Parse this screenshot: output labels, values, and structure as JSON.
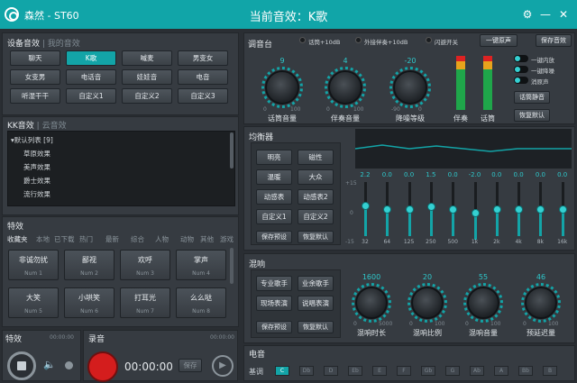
{
  "app": {
    "name": "森然 - ST60",
    "title": "当前音效：K歌"
  },
  "device_effects": {
    "title": "设备音效",
    "sub": "我的音效",
    "buttons": [
      "聊天",
      "K歌",
      "喊麦",
      "男变女",
      "女变男",
      "电话音",
      "娃娃音",
      "电音",
      "听湿干干",
      "自定义1",
      "自定义2",
      "自定义3"
    ],
    "active": "K歌"
  },
  "kk_effects": {
    "title": "KK音效",
    "sub": "云音效",
    "list": [
      "▾默认列表 [9]",
      "草原效果",
      "美声效果",
      "爵士效果",
      "流行效果"
    ]
  },
  "special": {
    "title": "特效",
    "tabs": [
      "收藏夹",
      "本地",
      "已下载",
      "热门",
      "最新",
      "综合",
      "人物",
      "动物",
      "其他",
      "游戏"
    ],
    "active_tab": "收藏夹",
    "buttons": [
      {
        "name": "非诚勿扰",
        "key": "Num 1"
      },
      {
        "name": "鄙视",
        "key": "Num 2"
      },
      {
        "name": "欢呼",
        "key": "Num 3"
      },
      {
        "name": "掌声",
        "key": "Num 4"
      },
      {
        "name": "大笑",
        "key": "Num 5"
      },
      {
        "name": "小哄笑",
        "key": "Num 6"
      },
      {
        "name": "打耳光",
        "key": "Num 7"
      },
      {
        "name": "么么哒",
        "key": "Num 8"
      }
    ]
  },
  "bottom": {
    "effect_label": "特效",
    "effect_time": "00:00:00",
    "record_label": "录音",
    "record_time": "00:00:00",
    "record_time_big": "00:00:00",
    "save": "保存"
  },
  "mixer": {
    "title": "调音台",
    "checks": [
      "话筒+10dB",
      "外接伴奏+10dB",
      "闪避开关"
    ],
    "btn_karaoke": "一键原声",
    "btn_save": "保存音效",
    "knobs": [
      {
        "label": "话筒音量",
        "value": "9"
      },
      {
        "label": "伴奏音量",
        "value": "4"
      },
      {
        "label": "降噪等级",
        "value": "-20"
      }
    ],
    "knob_marks": [
      "0",
      "100",
      "0",
      "100",
      "-90",
      "0"
    ],
    "vu_labels": [
      "伴奏",
      "话筒"
    ],
    "toggles": [
      "一键内放",
      "一键降噪",
      "消原声"
    ],
    "btn_mute": "话筒静音",
    "btn_reset": "恢复默认"
  },
  "eq": {
    "title": "均衡器",
    "presets": [
      "明亮",
      "磁性",
      "温暖",
      "大众",
      "动感表",
      "动感表2",
      "自定义1",
      "自定义2"
    ],
    "btn_save": "保存预设",
    "btn_reset": "恢复默认",
    "values": [
      "2.2",
      "0.0",
      "0.0",
      "1.5",
      "0.0",
      "-2.0",
      "0.0",
      "0.0",
      "0.0",
      "0.0"
    ],
    "freqs": [
      "32",
      "64",
      "125",
      "250",
      "500",
      "1k",
      "2k",
      "4k",
      "8k",
      "16k"
    ],
    "scale": [
      "+15",
      "0",
      "-15"
    ],
    "levels": [
      2.2,
      0,
      0,
      1.5,
      0,
      -2,
      0,
      0,
      0,
      0
    ]
  },
  "reverb": {
    "title": "混响",
    "presets": [
      "专业歌手",
      "业余歌手",
      "现场表演",
      "说唱表演"
    ],
    "btn_save": "保存预设",
    "btn_reset": "恢复默认",
    "knobs": [
      {
        "label": "混响时长",
        "value": "1600"
      },
      {
        "label": "混响比例",
        "value": "20"
      },
      {
        "label": "混响音量",
        "value": "55"
      },
      {
        "label": "预延迟量",
        "value": "46"
      }
    ],
    "knob_marks": [
      "0",
      "5000",
      "0",
      "100",
      "0",
      "100",
      "0",
      "100"
    ]
  },
  "electro": {
    "title": "电音",
    "key_label": "基调",
    "keys": [
      "C",
      "Db",
      "D",
      "Eb",
      "E",
      "F",
      "Gb",
      "G",
      "Ab",
      "A",
      "Bb",
      "B"
    ],
    "active_key": "C"
  }
}
